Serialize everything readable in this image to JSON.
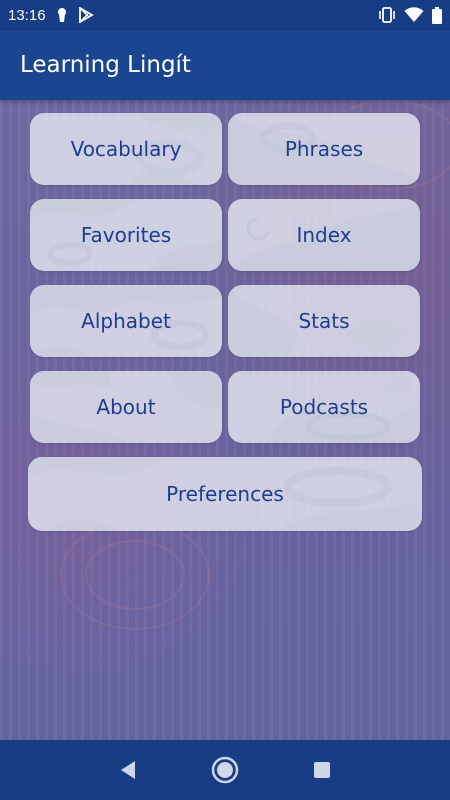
{
  "status_bar": {
    "time": "13:16",
    "left_icons": [
      "keyhole-icon",
      "play-store-icon"
    ],
    "right_icons": [
      "vibrate-icon",
      "wifi-icon",
      "battery-icon"
    ]
  },
  "app_bar": {
    "title": "Learning Lingít"
  },
  "menu": {
    "vocabulary": "Vocabulary",
    "phrases": "Phrases",
    "favorites": "Favorites",
    "index": "Index",
    "alphabet": "Alphabet",
    "stats": "Stats",
    "about": "About",
    "podcasts": "Podcasts",
    "preferences": "Preferences"
  },
  "nav_bar": {
    "icons": [
      "back-icon",
      "home-icon",
      "recents-icon"
    ]
  },
  "colors": {
    "status_bar": "#173d85",
    "app_bar": "#1a4690",
    "button_text": "#1f3d8f",
    "button_bg": "#e1e4ee",
    "background": "#6c6aa3"
  }
}
